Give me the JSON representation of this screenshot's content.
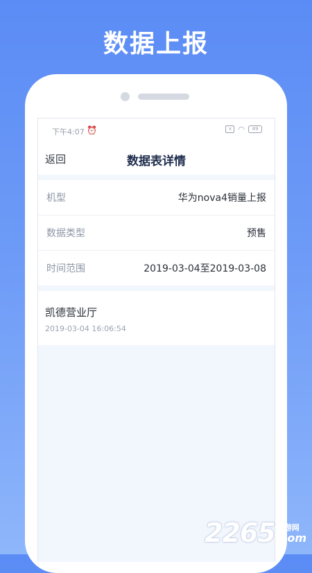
{
  "promo": {
    "title": "数据上报"
  },
  "statusbar": {
    "time": "下午4:07",
    "battery": "49"
  },
  "navbar": {
    "back_label": "返回",
    "title": "数据表详情"
  },
  "info": {
    "rows": [
      {
        "label": "机型",
        "value": "华为nova4销量上报"
      },
      {
        "label": "数据类型",
        "value": "预售"
      },
      {
        "label": "时间范围",
        "value": "2019-03-04至2019-03-08"
      }
    ]
  },
  "record": {
    "name": "凯德营业厅",
    "time": "2019-03-04 16:06:54"
  },
  "watermark": {
    "digits": "2265",
    "site": "手游网",
    "suffix": ".com"
  }
}
